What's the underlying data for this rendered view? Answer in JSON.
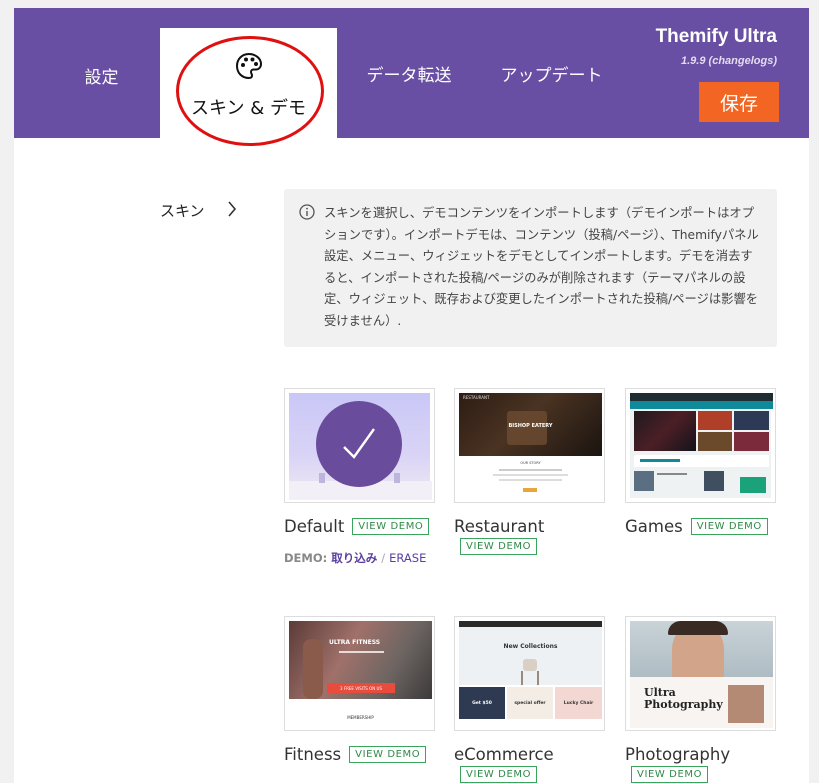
{
  "tabs": {
    "settings": "設定",
    "skins_demo": "スキン & デモ",
    "data_transfer": "データ転送",
    "update": "アップデート"
  },
  "brand": {
    "name": "Themify Ultra",
    "version": "1.9.9",
    "changelogs": "changelogs"
  },
  "save_label": "保存",
  "side_label": "スキン",
  "notice": "スキンを選択し、デモコンテンツをインポートします（デモインポートはオプションです）。インポートデモは、コンテンツ（投稿/ページ）、Themifyパネル設定、メニュー、ウィジェットをデモとしてインポートします。デモを消去すると、インポートされた投稿/ページのみが削除されます（テーマパネルの設定、ウィジェット、既存および変更したインポートされた投稿/ページは影響を受けません）.",
  "view_demo": "VIEW DEMO",
  "demo_actions": {
    "prefix": "DEMO:",
    "import": "取り込み",
    "separator": "/",
    "erase": "ERASE"
  },
  "thumb_text": {
    "restaurant_brand": "RESTAURANT",
    "restaurant_heading": "BISHOP EATERY",
    "restaurant_story": "OUR STORY",
    "fitness_heading": "ULTRA FITNESS",
    "fitness_cta": "3 FREE VISITS ON US",
    "fitness_membership": "MEMBERSHIP",
    "ecommerce_heading": "New Collections",
    "ecommerce_price": "Get $50",
    "ecommerce_offer": "special offer",
    "ecommerce_chair": "Lucky Chair",
    "photography_heading_1": "Ultra",
    "photography_heading_2": "Photography"
  },
  "demos": [
    {
      "name": "Default",
      "selected": true
    },
    {
      "name": "Restaurant",
      "selected": false
    },
    {
      "name": "Games",
      "selected": false
    },
    {
      "name": "Fitness",
      "selected": false
    },
    {
      "name": "eCommerce",
      "selected": false
    },
    {
      "name": "Photography",
      "selected": false
    }
  ],
  "colors": {
    "header": "#694fa3",
    "save_button": "#f26522",
    "check_circle": "#6a4c9c",
    "view_demo": "#3aa45c",
    "annotation_circle": "#e01010"
  }
}
